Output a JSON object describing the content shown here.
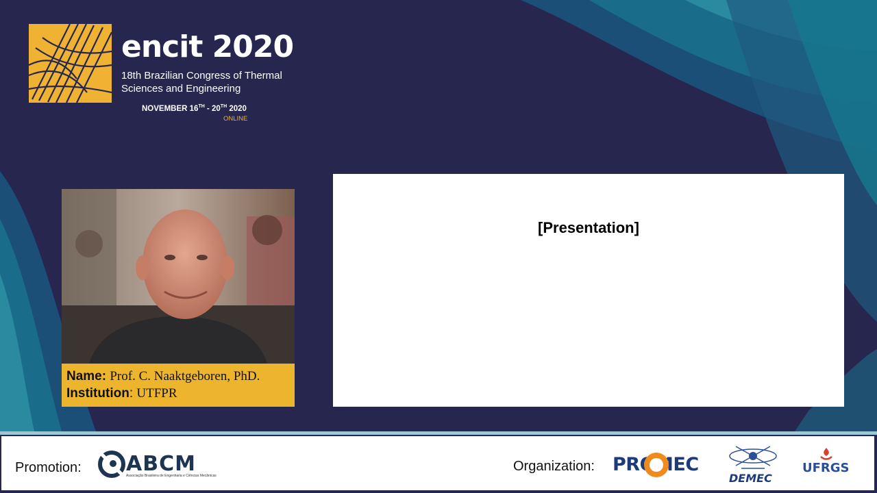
{
  "brand": {
    "title": "encit 2020",
    "subtitle": "18th Brazilian Congress of Thermal Sciences and Engineering",
    "dates_prefix": "NOVEMBER 16",
    "dates_sup1": "TH",
    "dates_mid": " - 20",
    "dates_sup2": "TH",
    "dates_suffix": " 2020",
    "mode": "ONLINE"
  },
  "speaker": {
    "name_label": "Name:",
    "name": "Prof. C. Naaktgeboren, PhD.",
    "institution_label": "Institution",
    "institution_sep": ":",
    "institution": "UTFPR"
  },
  "slide": {
    "placeholder": "[Presentation]"
  },
  "footer": {
    "promotion_label": "Promotion:",
    "abcm_logo": "ABCM",
    "abcm_tagline": "Associação Brasileira de Engenharia e Ciências Mecânicas",
    "organization_label": "Organization:",
    "promec_logo": "PROMEC",
    "demec_logo": "DEMEC",
    "ufrgs_logo": "UFRGS"
  },
  "colors": {
    "background": "#26264f",
    "accent_yellow": "#ecb52d",
    "teal": "#1a6d8a"
  }
}
